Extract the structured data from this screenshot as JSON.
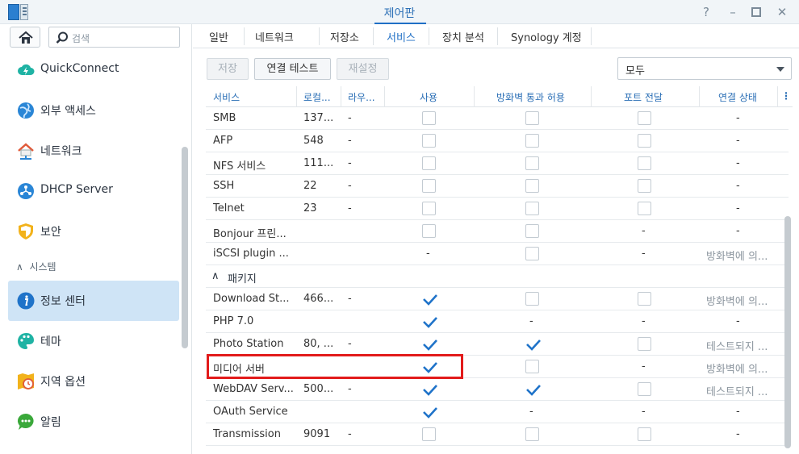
{
  "window": {
    "title": "제어판"
  },
  "sidebar": {
    "search_placeholder": "검색",
    "group_label": "시스템",
    "items": [
      {
        "label": "QuickConnect",
        "icon": "quickconnect-icon"
      },
      {
        "label": "외부 액세스",
        "icon": "external-access-icon"
      },
      {
        "label": "네트워크",
        "icon": "network-icon"
      },
      {
        "label": "DHCP Server",
        "icon": "dhcp-icon"
      },
      {
        "label": "보안",
        "icon": "security-shield-icon"
      },
      {
        "label": "정보 센터",
        "icon": "info-icon"
      },
      {
        "label": "테마",
        "icon": "theme-palette-icon"
      },
      {
        "label": "지역 옵션",
        "icon": "regional-options-icon"
      },
      {
        "label": "알림",
        "icon": "notification-icon"
      }
    ]
  },
  "tabs": [
    "일반",
    "네트워크",
    "저장소",
    "서비스",
    "장치 분석",
    "Synology 계정"
  ],
  "active_tab": "서비스",
  "toolbar": {
    "save_label": "저장",
    "test_label": "연결 테스트",
    "reset_label": "재설정",
    "filter_value": "모두"
  },
  "table": {
    "headers": [
      "서비스",
      "로컬...",
      "라우...",
      "사용",
      "방화벽 통과 허용",
      "포트 전달",
      "연결 상태"
    ],
    "group_label": "패키지",
    "rows": [
      {
        "service": "SMB",
        "local": "137...",
        "router": "-",
        "use": "off",
        "fw": "off",
        "pf": "off",
        "status": "-"
      },
      {
        "service": "AFP",
        "local": "548",
        "router": "-",
        "use": "off",
        "fw": "off",
        "pf": "off",
        "status": "-"
      },
      {
        "service": "NFS 서비스",
        "local": "111...",
        "router": "-",
        "use": "off",
        "fw": "off",
        "pf": "off",
        "status": "-"
      },
      {
        "service": "SSH",
        "local": "22",
        "router": "-",
        "use": "off",
        "fw": "off",
        "pf": "off",
        "status": "-"
      },
      {
        "service": "Telnet",
        "local": "23",
        "router": "-",
        "use": "off",
        "fw": "off",
        "pf": "off",
        "status": "-"
      },
      {
        "service": "Bonjour 프린...",
        "local": "",
        "router": "",
        "use": "off",
        "fw": "off",
        "pf": "-",
        "status": "-"
      },
      {
        "service": "iSCSI plugin ...",
        "local": "",
        "router": "",
        "use": "-",
        "fw": "off",
        "pf": "-",
        "status": "방화벽에 의..."
      }
    ],
    "package_rows": [
      {
        "service": "Download St...",
        "local": "466...",
        "router": "-",
        "use": "on",
        "fw": "off",
        "pf": "off",
        "status": "방화벽에 의..."
      },
      {
        "service": "PHP 7.0",
        "local": "",
        "router": "",
        "use": "on",
        "fw": "-",
        "pf": "-",
        "status": "-"
      },
      {
        "service": "Photo Station",
        "local": "80, ...",
        "router": "-",
        "use": "on",
        "fw": "on",
        "pf": "off",
        "status": "테스트되지 ..."
      },
      {
        "service": "미디어 서버",
        "local": "",
        "router": "",
        "use": "on",
        "fw": "off",
        "pf": "-",
        "status": "방화벽에 의..."
      },
      {
        "service": "WebDAV Serv...",
        "local": "500...",
        "router": "-",
        "use": "on",
        "fw": "on",
        "pf": "off",
        "status": "테스트되지 ..."
      },
      {
        "service": "OAuth Service",
        "local": "",
        "router": "",
        "use": "on",
        "fw": "-",
        "pf": "-",
        "status": "-"
      },
      {
        "service": "Transmission",
        "local": "9091",
        "router": "-",
        "use": "off",
        "fw": "off",
        "pf": "off",
        "status": "-"
      }
    ]
  },
  "colors": {
    "accent": "#1f6fc5",
    "highlight": "#e21b1b",
    "active_nav": "#cfe4f6"
  }
}
